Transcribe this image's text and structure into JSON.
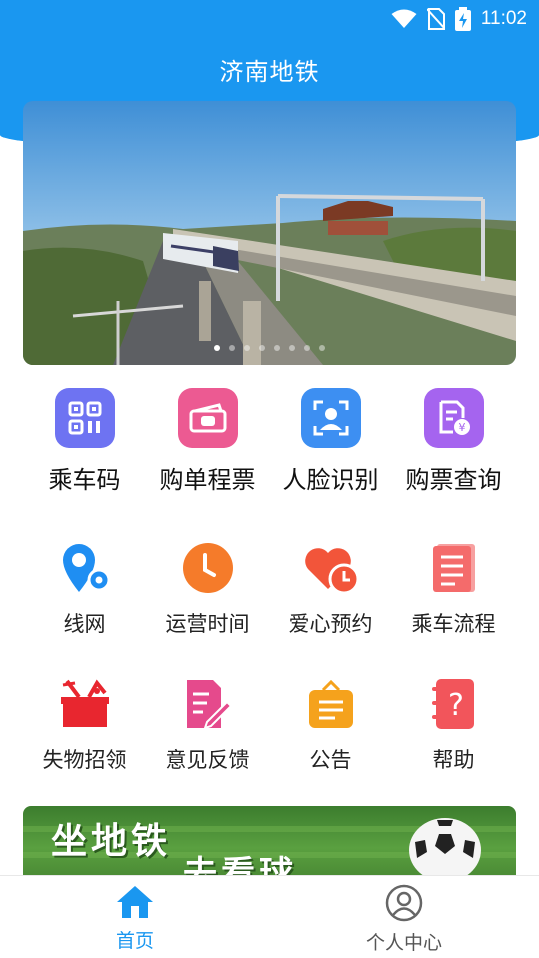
{
  "status_bar": {
    "time": "11:02",
    "icons": [
      "wifi-icon",
      "no-sim-icon",
      "battery-charging-icon"
    ]
  },
  "app": {
    "title": "济南地铁"
  },
  "banner": {
    "image": "elevated-metro-train-photo",
    "slides": 8,
    "active_slide": 1
  },
  "primary_actions": [
    {
      "label": "乘车码",
      "icon": "qr-code-icon",
      "color": "#6e73f2"
    },
    {
      "label": "购单程票",
      "icon": "ticket-icon",
      "color": "#ec5a92"
    },
    {
      "label": "人脸识别",
      "icon": "face-scan-icon",
      "color": "#3d8ff2"
    },
    {
      "label": "购票查询",
      "icon": "ticket-search-icon",
      "color": "#a564ef"
    }
  ],
  "service_row_1": [
    {
      "label": "线网",
      "icon": "map-pin-icon",
      "color": "#1f8ef2"
    },
    {
      "label": "运营时间",
      "icon": "clock-icon",
      "color": "#f57b2a"
    },
    {
      "label": "爱心预约",
      "icon": "heart-clock-icon",
      "color": "#f2553a"
    },
    {
      "label": "乘车流程",
      "icon": "document-list-icon",
      "color": "#f46b6b"
    }
  ],
  "service_row_2": [
    {
      "label": "失物招领",
      "icon": "lost-found-icon",
      "color": "#e8262f"
    },
    {
      "label": "意见反馈",
      "icon": "feedback-edit-icon",
      "color": "#e54a8c"
    },
    {
      "label": "公告",
      "icon": "notice-board-icon",
      "color": "#f5a21c"
    },
    {
      "label": "帮助",
      "icon": "help-notebook-icon",
      "color": "#f2555b"
    }
  ],
  "promo": {
    "line1": "坐地铁",
    "line2": "去看球"
  },
  "bottom_nav": [
    {
      "label": "首页",
      "icon": "home-icon",
      "active": true,
      "color": "#1a97f0"
    },
    {
      "label": "个人中心",
      "icon": "user-circle-icon",
      "active": false,
      "color": "#555555"
    }
  ]
}
